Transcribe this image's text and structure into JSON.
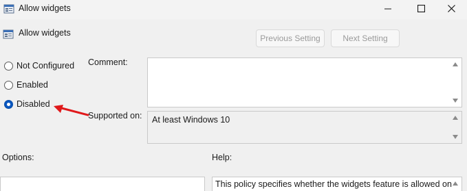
{
  "window": {
    "title": "Allow widgets",
    "controls": {
      "minimize_icon": "minimize-icon",
      "maximize_icon": "maximize-icon",
      "close_icon": "close-icon"
    }
  },
  "header": {
    "title": "Allow widgets",
    "prev_label": "Previous Setting",
    "next_label": "Next Setting"
  },
  "state": {
    "options": [
      {
        "label": "Not Configured",
        "checked": false
      },
      {
        "label": "Enabled",
        "checked": false
      },
      {
        "label": "Disabled",
        "checked": true
      }
    ]
  },
  "comment": {
    "label": "Comment:",
    "value": ""
  },
  "supported": {
    "label": "Supported on:",
    "value": "At least Windows 10"
  },
  "options_section": {
    "label": "Options:"
  },
  "help": {
    "label": "Help:",
    "text": "This policy specifies whether the widgets feature is allowed on"
  },
  "annotation": {
    "type": "arrow",
    "color": "#e0191b"
  },
  "colors": {
    "accent": "#0a57c0",
    "background": "#f0f0f0"
  }
}
